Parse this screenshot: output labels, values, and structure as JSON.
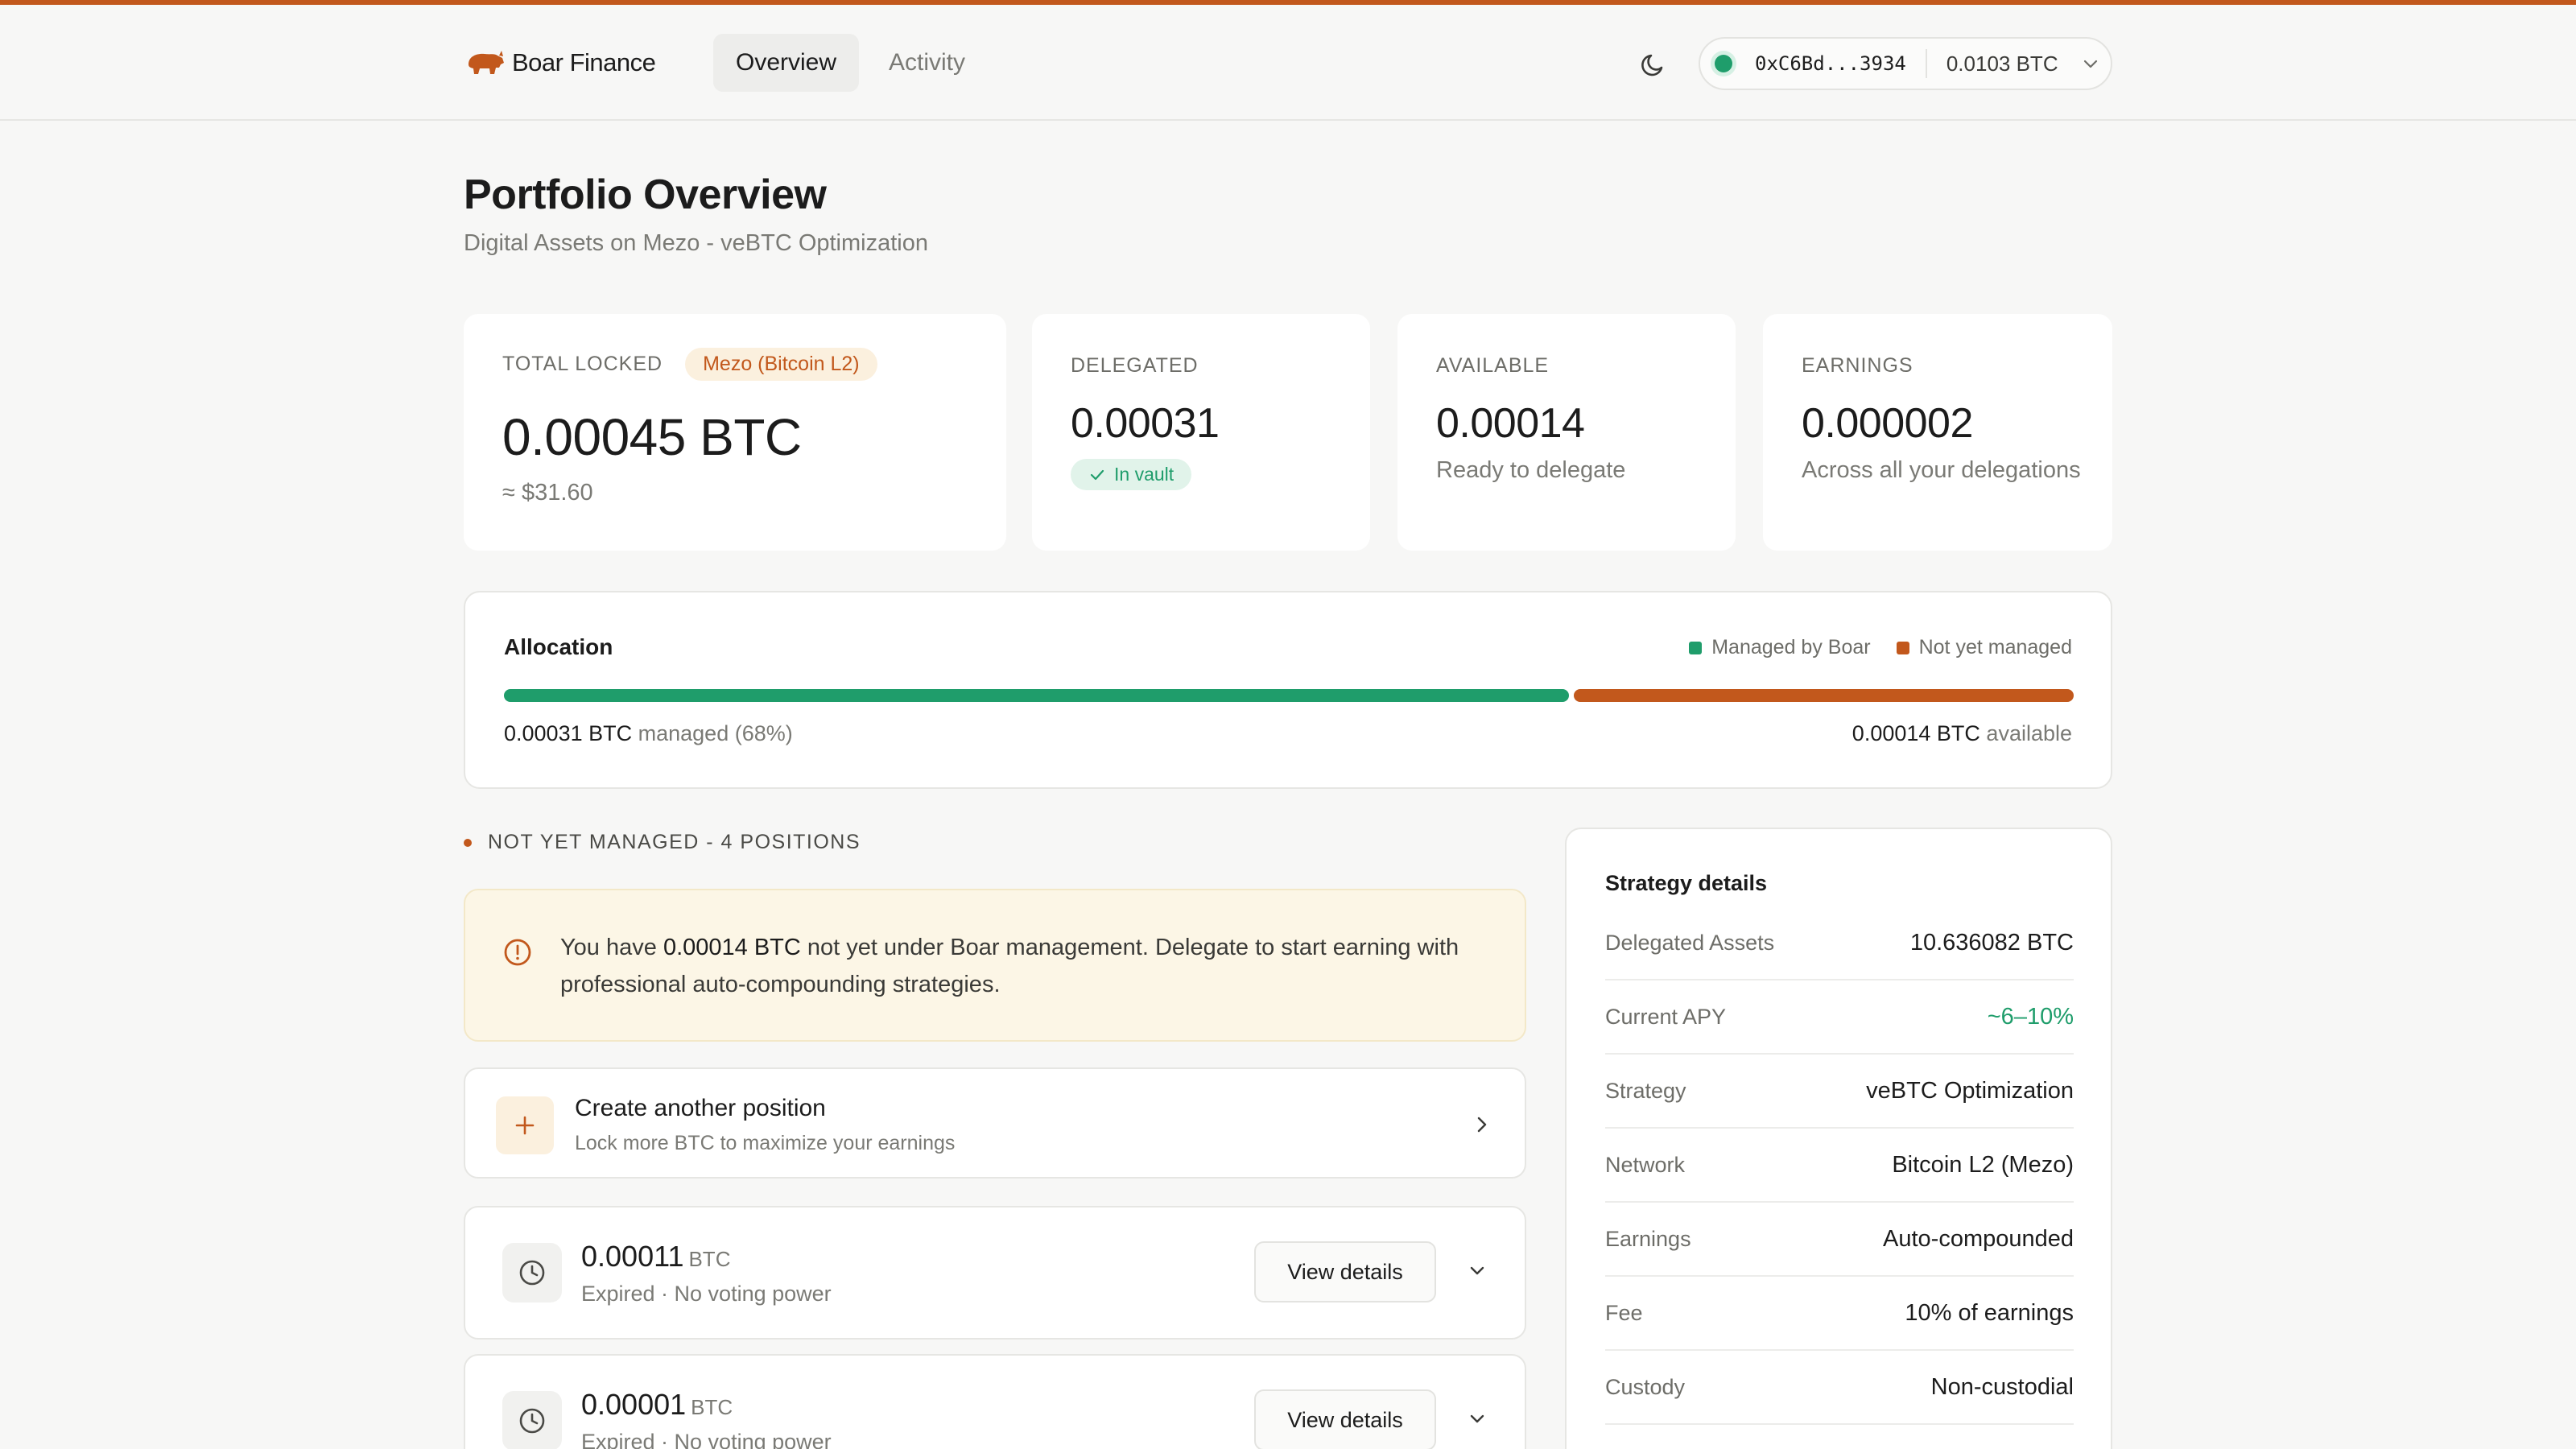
{
  "app": {
    "name": "Boar Finance"
  },
  "nav": {
    "tabs": [
      {
        "label": "Overview"
      },
      {
        "label": "Activity"
      }
    ]
  },
  "wallet": {
    "address": "0xC6Bd...3934",
    "balance": "0.0103 BTC"
  },
  "page": {
    "title": "Portfolio Overview",
    "subtitle": "Digital Assets on Mezo - veBTC Optimization"
  },
  "stats": {
    "total_locked": {
      "label": "TOTAL LOCKED",
      "chip": "Mezo (Bitcoin L2)",
      "value": "0.00045 BTC",
      "usd": "≈ $31.60"
    },
    "delegated": {
      "label": "DELEGATED",
      "value": "0.00031",
      "chip": "In vault"
    },
    "available": {
      "label": "AVAILABLE",
      "value": "0.00014",
      "note": "Ready to delegate"
    },
    "earnings": {
      "label": "EARNINGS",
      "value": "0.000002",
      "note": "Across all your delegations"
    }
  },
  "allocation": {
    "title": "Allocation",
    "legend": [
      {
        "label": "Managed by Boar",
        "color": "#1f9d6b"
      },
      {
        "label": "Not yet managed",
        "color": "#c2581c"
      }
    ],
    "managed_fraction": 0.68,
    "managed_amount": "0.00031 BTC",
    "managed_text": "managed (68%)",
    "available_amount": "0.00014 BTC",
    "available_text": "available"
  },
  "section": {
    "label": "NOT YET MANAGED - 4 POSITIONS"
  },
  "notice": {
    "prefix": "You have",
    "amount": "0.00014 BTC",
    "suffix": "not yet under Boar management. Delegate to start earning with professional auto-compounding strategies."
  },
  "create_position": {
    "title": "Create another position",
    "subtitle": "Lock more BTC to maximize your earnings"
  },
  "positions": [
    {
      "amount": "0.00011",
      "unit": "BTC",
      "status": "Expired · No voting power",
      "button": "View details"
    },
    {
      "amount": "0.00001",
      "unit": "BTC",
      "status": "Expired · No voting power",
      "button": "View details"
    }
  ],
  "strategy": {
    "title": "Strategy details",
    "rows": [
      {
        "key": "Delegated Assets",
        "value": "10.636082 BTC"
      },
      {
        "key": "Current APY",
        "value": "~6–10%"
      },
      {
        "key": "Strategy",
        "value": "veBTC Optimization"
      },
      {
        "key": "Network",
        "value": "Bitcoin L2 (Mezo)"
      },
      {
        "key": "Earnings",
        "value": "Auto-compounded"
      },
      {
        "key": "Fee",
        "value": "10% of earnings"
      },
      {
        "key": "Custody",
        "value": "Non-custodial"
      }
    ]
  },
  "colors": {
    "accent": "#c2581c",
    "managed": "#1f9d6b",
    "available": "#c2581c"
  }
}
